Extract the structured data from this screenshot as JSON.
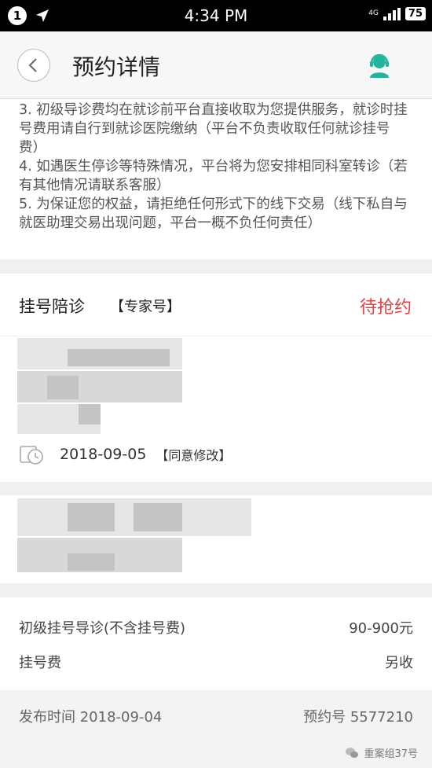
{
  "status_bar": {
    "notification_count": "1",
    "time": "4:34 PM",
    "network": "4G",
    "battery": "75"
  },
  "nav": {
    "title": "预约详情"
  },
  "notice": {
    "lines": [
      "3. 初级导诊费均在就诊前平台直接收取为您提供服务，就诊时挂号费用请自行到就诊医院缴纳（平台不负责收取任何就诊挂号费）",
      "4. 如遇医生停诊等特殊情况，平台将为您安排相同科室转诊（若有其他情况请联系客服）",
      "5. 为保证您的权益，请拒绝任何形式下的线下交易（线下私自与就医助理交易出现问题，平台一概不负任何责任）"
    ]
  },
  "appointment": {
    "service_name": "挂号陪诊",
    "service_tag": "【专家号】",
    "status": "待抢约",
    "date": "2018-09-05",
    "agree_label": "【同意修改】"
  },
  "fees": {
    "guide_label": "初级挂号导诊(不含挂号费)",
    "guide_value": "90-900元",
    "registration_label": "挂号费",
    "registration_value": "另收"
  },
  "footer": {
    "publish_label": "发布时间",
    "publish_date": "2018-09-04",
    "order_label": "预约号",
    "order_number": "5577210"
  },
  "watermark": {
    "text": "重案组37号"
  },
  "colors": {
    "accent_green": "#22b59b",
    "status_red": "#e0403f"
  }
}
